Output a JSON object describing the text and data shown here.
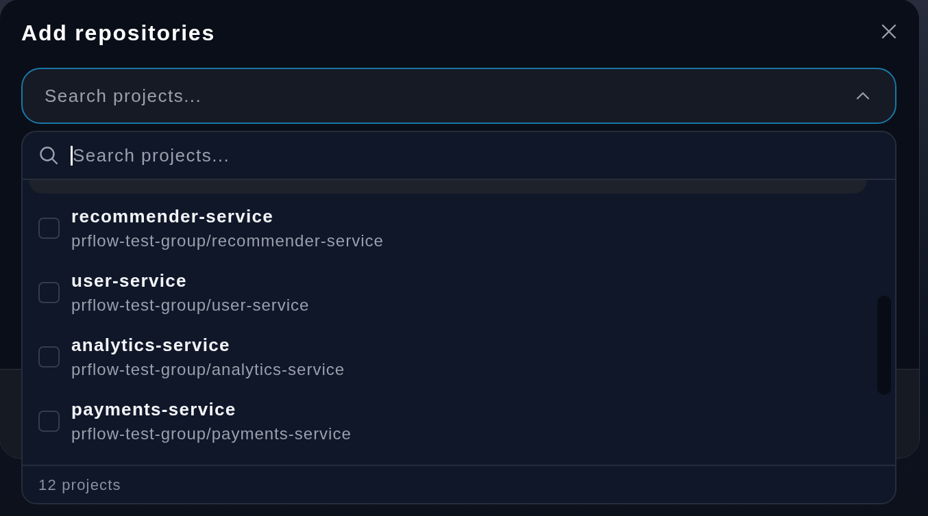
{
  "dialog": {
    "title": "Add repositories"
  },
  "project_select": {
    "placeholder": "Search projects...",
    "expanded": true
  },
  "dropdown": {
    "search": {
      "placeholder": "Search projects...",
      "focused": true
    },
    "options": [
      {
        "highlighted": true
      },
      {
        "name": "recommender-service",
        "path": "prflow-test-group/recommender-service",
        "checked": false,
        "highlighted": false
      },
      {
        "name": "user-service",
        "path": "prflow-test-group/user-service",
        "checked": false,
        "highlighted": false
      },
      {
        "name": "analytics-service",
        "path": "prflow-test-group/analytics-service",
        "checked": false,
        "highlighted": false
      },
      {
        "name": "payments-service",
        "path": "prflow-test-group/payments-service",
        "checked": false,
        "highlighted": false
      }
    ],
    "count": "12 projects"
  }
}
